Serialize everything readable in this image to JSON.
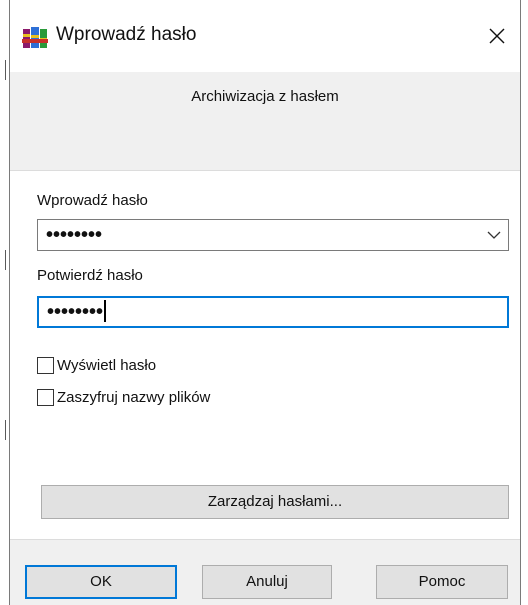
{
  "window": {
    "title": "Wprowadź hasło",
    "subtitle": "Archiwizacja z hasłem"
  },
  "icons": {
    "app": "winrar-books-icon",
    "close": "close-icon",
    "combo_arrow": "chevron-down-icon"
  },
  "form": {
    "password_label": "Wprowadź hasło",
    "password_value": "••••••••",
    "confirm_label": "Potwierdź hasło",
    "confirm_value": "••••••••",
    "show_password_label": "Wyświetl hasło",
    "show_password_checked": false,
    "encrypt_filenames_label": "Zaszyfruj nazwy plików",
    "encrypt_filenames_checked": false,
    "manage_label": "Zarządzaj hasłami..."
  },
  "buttons": {
    "ok": "OK",
    "cancel": "Anuluj",
    "help": "Pomoc"
  },
  "colors": {
    "focus_border": "#0078d7",
    "dialog_bg": "#f0f0f0",
    "button_bg": "#e1e1e1"
  }
}
